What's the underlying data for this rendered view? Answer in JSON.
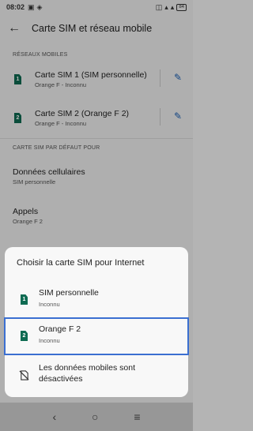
{
  "status_bar": {
    "time": "08:02",
    "battery": "84"
  },
  "header": {
    "title": "Carte SIM et réseau mobile"
  },
  "networks_section": {
    "label": "RÉSEAUX MOBILES",
    "sims": [
      {
        "slot": "1",
        "name": "Carte SIM 1 (SIM personnelle)",
        "status": "Orange F - Inconnu"
      },
      {
        "slot": "2",
        "name": "Carte SIM 2 (Orange F 2)",
        "status": "Orange F - Inconnu"
      }
    ]
  },
  "default_section": {
    "label": "CARTE SIM PAR DÉFAUT POUR",
    "items": [
      {
        "title": "Données cellulaires",
        "value": "SIM personnelle"
      },
      {
        "title": "Appels",
        "value": "Orange F 2"
      }
    ]
  },
  "dialog": {
    "title": "Choisir la carte SIM pour Internet",
    "options": [
      {
        "slot": "1",
        "label": "SIM personnelle",
        "sub": "Inconnu"
      },
      {
        "slot": "2",
        "label": "Orange F 2",
        "sub": "Inconnu"
      },
      {
        "label_line1": "Les données mobiles sont",
        "label_line2": "désactivées"
      }
    ]
  },
  "nav": {
    "back": "‹",
    "home": "○",
    "menu": "≡"
  }
}
